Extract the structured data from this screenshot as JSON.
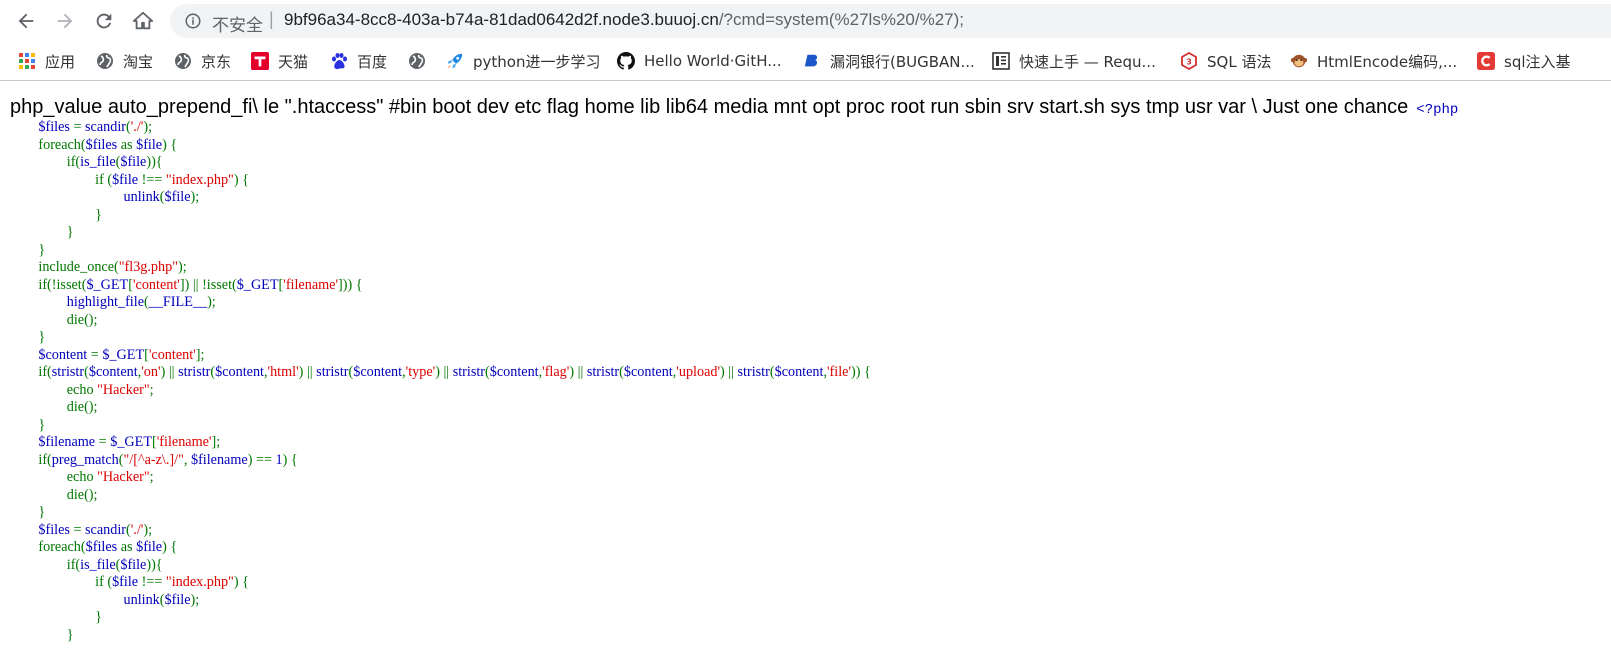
{
  "browser": {
    "security_label": "不安全",
    "url_host": "9bf96a34-8cc8-403a-b74a-81dad0642d2f.node3.buuoj.cn",
    "url_path": "/?cmd=system(%27ls%20/%27);"
  },
  "bookmarks": [
    {
      "label": "应用",
      "icon": "apps-grid-icon"
    },
    {
      "label": "淘宝",
      "icon": "globe-icon"
    },
    {
      "label": "京东",
      "icon": "globe-icon"
    },
    {
      "label": "天猫",
      "icon": "tmall-icon"
    },
    {
      "label": "百度",
      "icon": "baidu-paw-icon"
    },
    {
      "label": "",
      "icon": "globe-icon"
    },
    {
      "label": "python进一步学习",
      "icon": "rocket-icon"
    },
    {
      "label": "Hello World·GitH...",
      "icon": "github-icon"
    },
    {
      "label": "漏洞银行(BUGBAN...",
      "icon": "bugbank-icon"
    },
    {
      "label": "快速上手 — Requ...",
      "icon": "book-icon"
    },
    {
      "label": "SQL 语法",
      "icon": "w3-icon"
    },
    {
      "label": "HtmlEncode编码,...",
      "icon": "monkey-icon"
    },
    {
      "label": "sql注入基",
      "icon": "c-logo-icon"
    }
  ],
  "output": {
    "text": "php_value auto_prepend_fi\\ le \".htaccess\" #bin boot dev etc flag home lib lib64 media mnt opt proc root run sbin srv start.sh sys tmp usr var \\ Just one chance",
    "php_open": "<?php"
  },
  "colors": {
    "keyword": "#007700",
    "default": "#0000bb",
    "string": "#dd0000"
  },
  "code_lines": [
    [
      [
        "d",
        "$files"
      ],
      [
        "k",
        " = "
      ],
      [
        "d",
        "scandir"
      ],
      [
        "k",
        "("
      ],
      [
        "s",
        "'./'"
      ],
      [
        "k",
        ");"
      ]
    ],
    [
      [
        "k",
        "foreach("
      ],
      [
        "d",
        "$files "
      ],
      [
        "k",
        "as "
      ],
      [
        "d",
        "$file"
      ],
      [
        "k",
        ") {"
      ]
    ],
    [
      [
        "k",
        "        if("
      ],
      [
        "d",
        "is_file"
      ],
      [
        "k",
        "("
      ],
      [
        "d",
        "$file"
      ],
      [
        "k",
        ")){"
      ]
    ],
    [
      [
        "k",
        "                if ("
      ],
      [
        "d",
        "$file "
      ],
      [
        "k",
        "!== "
      ],
      [
        "s",
        "\"index.php\""
      ],
      [
        "k",
        ") {"
      ]
    ],
    [
      [
        "k",
        "                        "
      ],
      [
        "d",
        "unlink"
      ],
      [
        "k",
        "("
      ],
      [
        "d",
        "$file"
      ],
      [
        "k",
        ");"
      ]
    ],
    [
      [
        "k",
        "                }"
      ]
    ],
    [
      [
        "k",
        "        }"
      ]
    ],
    [
      [
        "k",
        "}"
      ]
    ],
    [
      [
        "k",
        "include_once("
      ],
      [
        "s",
        "\"fl3g.php\""
      ],
      [
        "k",
        ");"
      ]
    ],
    [
      [
        "k",
        "if(!isset("
      ],
      [
        "d",
        "$_GET"
      ],
      [
        "k",
        "["
      ],
      [
        "s",
        "'content'"
      ],
      [
        "k",
        "]) || !isset("
      ],
      [
        "d",
        "$_GET"
      ],
      [
        "k",
        "["
      ],
      [
        "s",
        "'filename'"
      ],
      [
        "k",
        "])) {"
      ]
    ],
    [
      [
        "k",
        "        "
      ],
      [
        "d",
        "highlight_file"
      ],
      [
        "k",
        "("
      ],
      [
        "d",
        "__FILE__"
      ],
      [
        "k",
        ");"
      ]
    ],
    [
      [
        "k",
        "        die();"
      ]
    ],
    [
      [
        "k",
        "}"
      ]
    ],
    [
      [
        "d",
        "$content "
      ],
      [
        "k",
        "= "
      ],
      [
        "d",
        "$_GET"
      ],
      [
        "k",
        "["
      ],
      [
        "s",
        "'content'"
      ],
      [
        "k",
        "];"
      ]
    ],
    [
      [
        "k",
        "if("
      ],
      [
        "d",
        "stristr"
      ],
      [
        "k",
        "("
      ],
      [
        "d",
        "$content"
      ],
      [
        "k",
        ","
      ],
      [
        "s",
        "'on'"
      ],
      [
        "k",
        ") || "
      ],
      [
        "d",
        "stristr"
      ],
      [
        "k",
        "("
      ],
      [
        "d",
        "$content"
      ],
      [
        "k",
        ","
      ],
      [
        "s",
        "'html'"
      ],
      [
        "k",
        ") || "
      ],
      [
        "d",
        "stristr"
      ],
      [
        "k",
        "("
      ],
      [
        "d",
        "$content"
      ],
      [
        "k",
        ","
      ],
      [
        "s",
        "'type'"
      ],
      [
        "k",
        ") || "
      ],
      [
        "d",
        "stristr"
      ],
      [
        "k",
        "("
      ],
      [
        "d",
        "$content"
      ],
      [
        "k",
        ","
      ],
      [
        "s",
        "'flag'"
      ],
      [
        "k",
        ") || "
      ],
      [
        "d",
        "stristr"
      ],
      [
        "k",
        "("
      ],
      [
        "d",
        "$content"
      ],
      [
        "k",
        ","
      ],
      [
        "s",
        "'upload'"
      ],
      [
        "k",
        ") || "
      ],
      [
        "d",
        "stristr"
      ],
      [
        "k",
        "("
      ],
      [
        "d",
        "$content"
      ],
      [
        "k",
        ","
      ],
      [
        "s",
        "'file'"
      ],
      [
        "k",
        ")) {"
      ]
    ],
    [
      [
        "k",
        "        echo "
      ],
      [
        "s",
        "\"Hacker\""
      ],
      [
        "k",
        ";"
      ]
    ],
    [
      [
        "k",
        "        die();"
      ]
    ],
    [
      [
        "k",
        "}"
      ]
    ],
    [
      [
        "d",
        "$filename "
      ],
      [
        "k",
        "= "
      ],
      [
        "d",
        "$_GET"
      ],
      [
        "k",
        "["
      ],
      [
        "s",
        "'filename'"
      ],
      [
        "k",
        "];"
      ]
    ],
    [
      [
        "k",
        "if("
      ],
      [
        "d",
        "preg_match"
      ],
      [
        "k",
        "("
      ],
      [
        "s",
        "\"/[^a-z\\.]/\""
      ],
      [
        "k",
        ", "
      ],
      [
        "d",
        "$filename"
      ],
      [
        "k",
        ") == "
      ],
      [
        "d",
        "1"
      ],
      [
        "k",
        ") {"
      ]
    ],
    [
      [
        "k",
        "        echo "
      ],
      [
        "s",
        "\"Hacker\""
      ],
      [
        "k",
        ";"
      ]
    ],
    [
      [
        "k",
        "        die();"
      ]
    ],
    [
      [
        "k",
        "}"
      ]
    ],
    [
      [
        "d",
        "$files "
      ],
      [
        "k",
        "= "
      ],
      [
        "d",
        "scandir"
      ],
      [
        "k",
        "("
      ],
      [
        "s",
        "'./'"
      ],
      [
        "k",
        ");"
      ]
    ],
    [
      [
        "k",
        "foreach("
      ],
      [
        "d",
        "$files "
      ],
      [
        "k",
        "as "
      ],
      [
        "d",
        "$file"
      ],
      [
        "k",
        ") {"
      ]
    ],
    [
      [
        "k",
        "        if("
      ],
      [
        "d",
        "is_file"
      ],
      [
        "k",
        "("
      ],
      [
        "d",
        "$file"
      ],
      [
        "k",
        ")){"
      ]
    ],
    [
      [
        "k",
        "                if ("
      ],
      [
        "d",
        "$file "
      ],
      [
        "k",
        "!== "
      ],
      [
        "s",
        "\"index.php\""
      ],
      [
        "k",
        ") {"
      ]
    ],
    [
      [
        "k",
        "                        "
      ],
      [
        "d",
        "unlink"
      ],
      [
        "k",
        "("
      ],
      [
        "d",
        "$file"
      ],
      [
        "k",
        ");"
      ]
    ],
    [
      [
        "k",
        "                }"
      ]
    ],
    [
      [
        "k",
        "        }"
      ]
    ]
  ]
}
